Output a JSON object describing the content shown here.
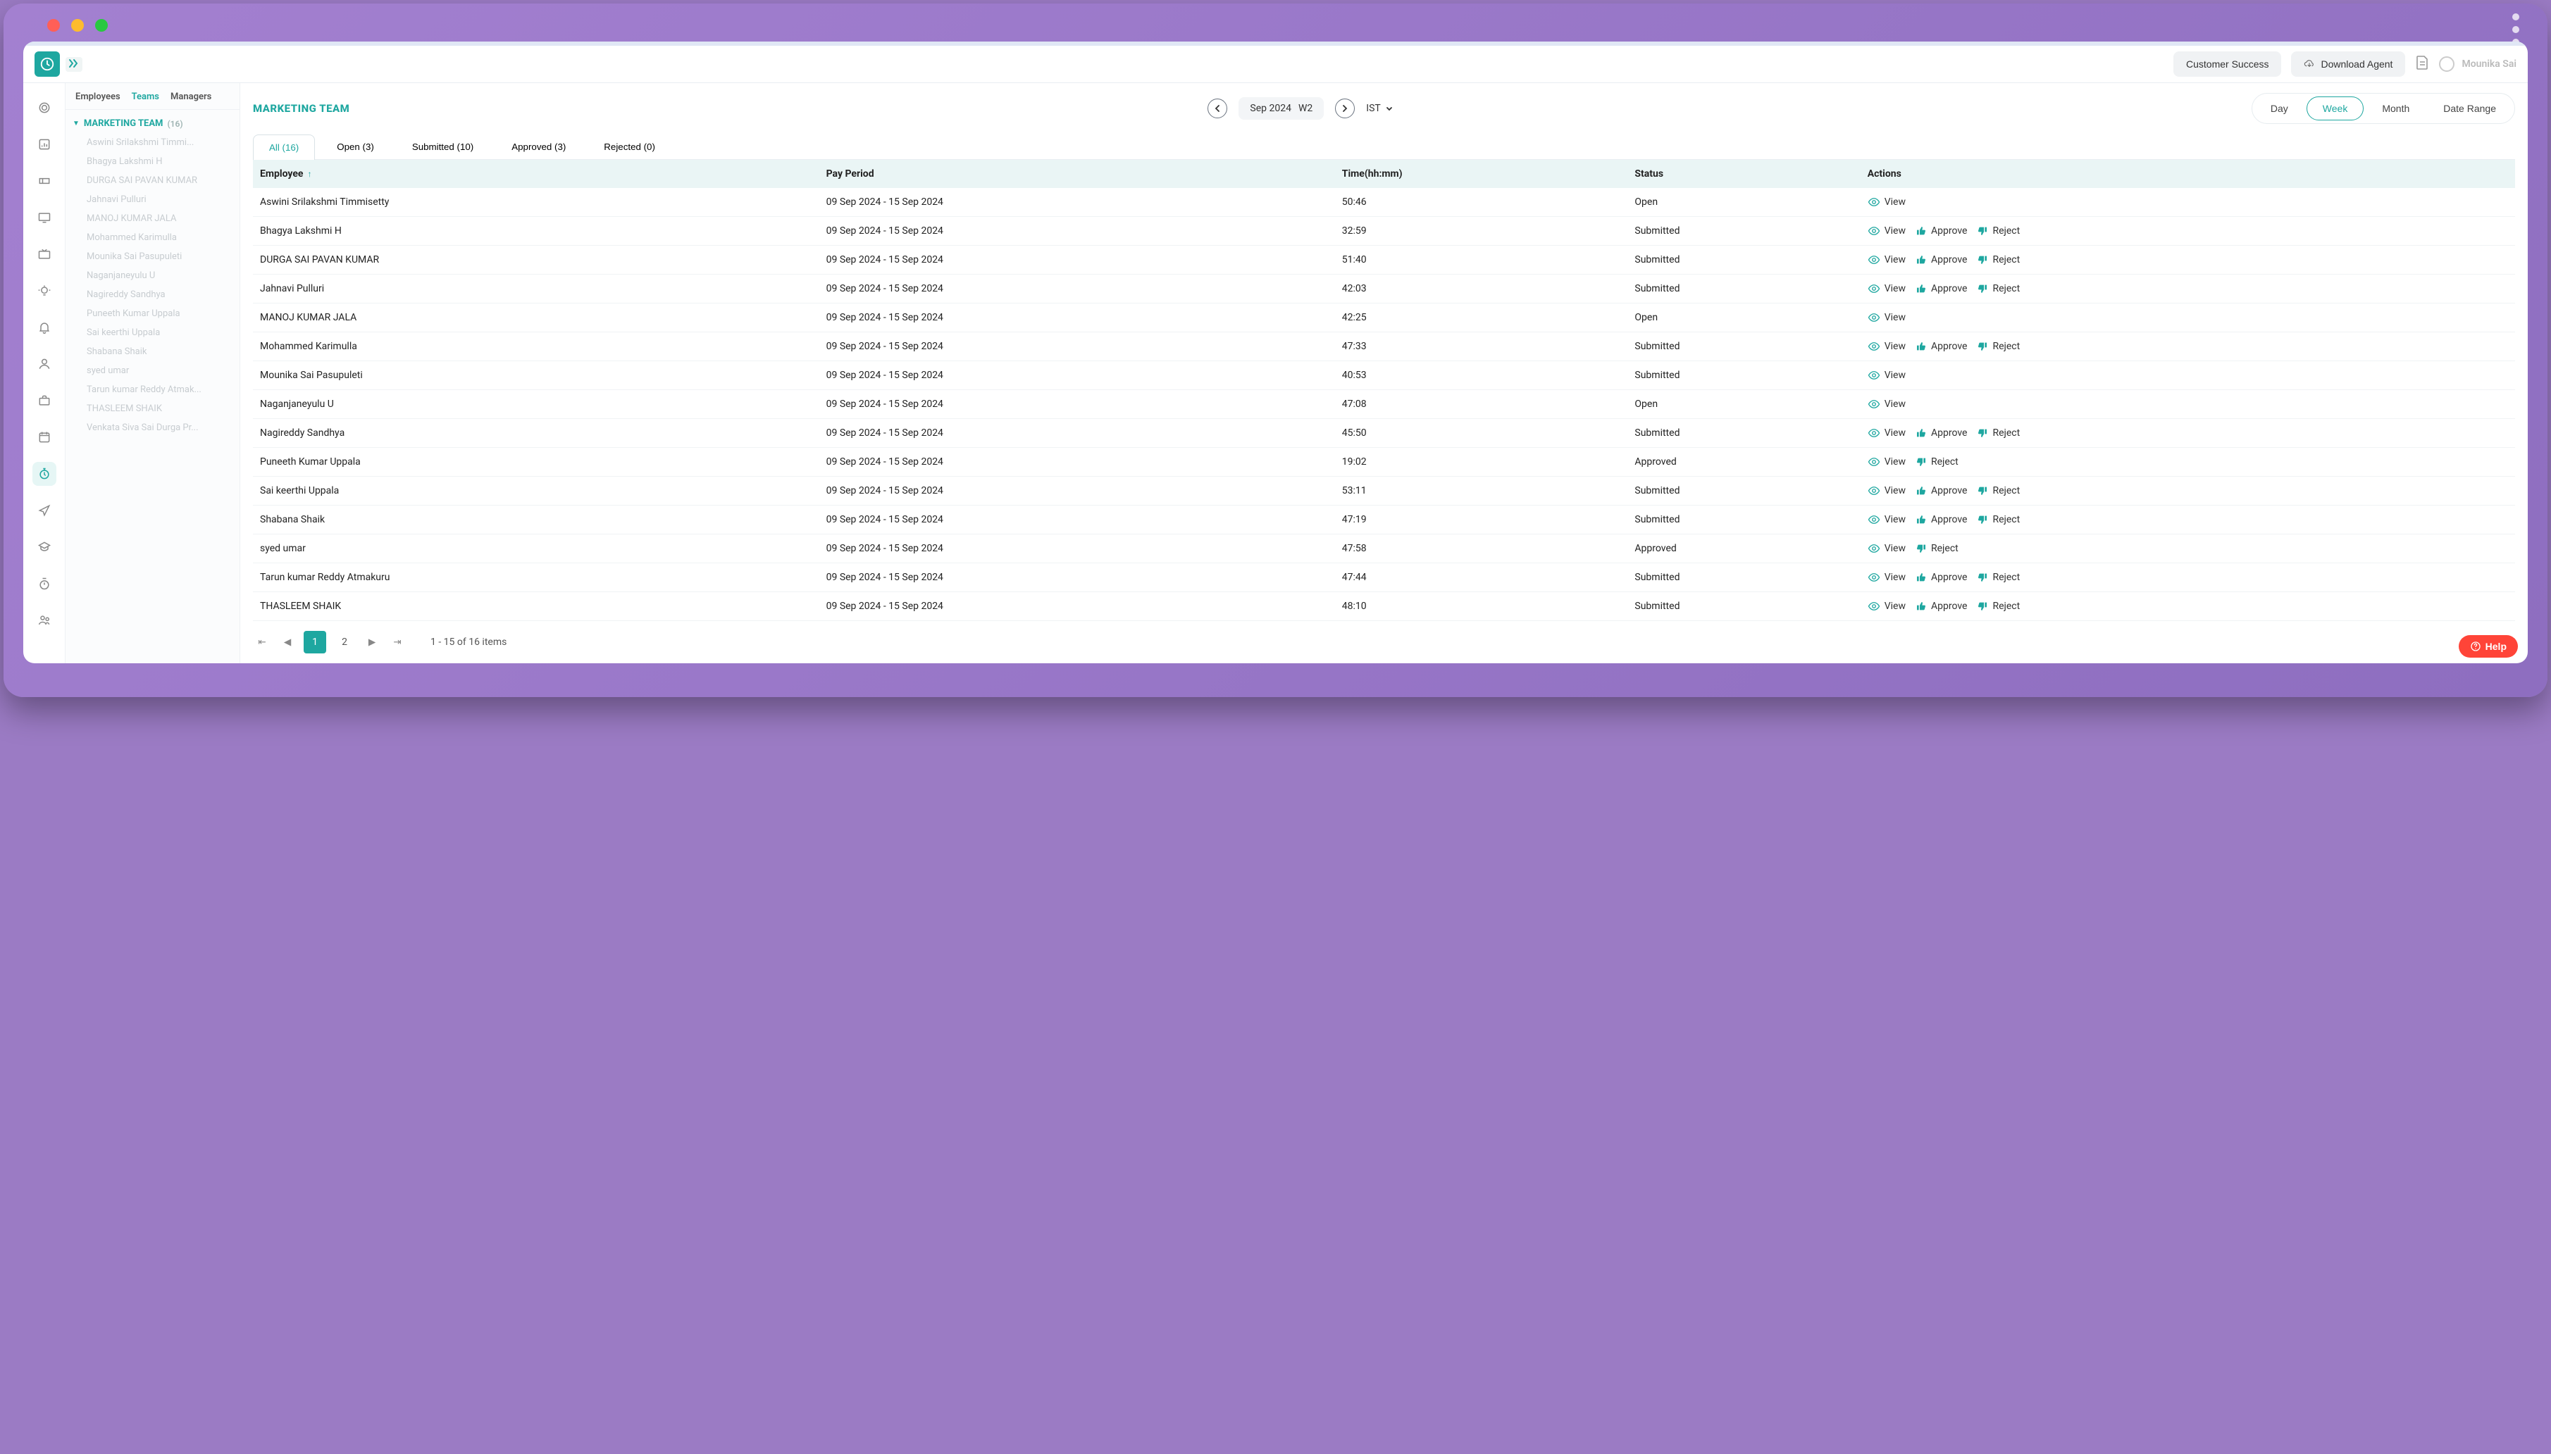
{
  "header": {
    "customer_btn": "Customer Success",
    "download_btn": "Download Agent",
    "user_name": "Mounika Sai"
  },
  "side_tabs": {
    "employees": "Employees",
    "teams": "Teams",
    "managers": "Managers"
  },
  "team": {
    "name": "MARKETING TEAM",
    "count": "(16)"
  },
  "employees": [
    "Aswini Srilakshmi Timmi...",
    "Bhagya Lakshmi H",
    "DURGA SAI PAVAN KUMAR",
    "Jahnavi Pulluri",
    "MANOJ KUMAR JALA",
    "Mohammed Karimulla",
    "Mounika Sai Pasupuleti",
    "Naganjaneyulu U",
    "Nagireddy Sandhya",
    "Puneeth Kumar Uppala",
    "Sai keerthi Uppala",
    "Shabana Shaik",
    "syed umar",
    "Tarun kumar Reddy Atmak...",
    "THASLEEM SHAIK",
    "Venkata Siva Sai Durga Pr..."
  ],
  "main": {
    "title": "MARKETING TEAM",
    "period_month": "Sep 2024",
    "period_week": "W2",
    "tz": "IST",
    "range": {
      "day": "Day",
      "week": "Week",
      "month": "Month",
      "daterange": "Date Range"
    }
  },
  "filters": {
    "all": "All (16)",
    "open": "Open (3)",
    "submitted": "Submitted (10)",
    "approved": "Approved (3)",
    "rejected": "Rejected (0)"
  },
  "columns": {
    "employee": "Employee",
    "payperiod": "Pay Period",
    "time": "Time(hh:mm)",
    "status": "Status",
    "actions": "Actions"
  },
  "action_labels": {
    "view": "View",
    "approve": "Approve",
    "reject": "Reject"
  },
  "rows": [
    {
      "emp": "Aswini Srilakshmi Timmisetty",
      "pp": "09 Sep 2024 - 15 Sep 2024",
      "time": "50:46",
      "status": "Open",
      "acts": [
        "view"
      ]
    },
    {
      "emp": "Bhagya Lakshmi H",
      "pp": "09 Sep 2024 - 15 Sep 2024",
      "time": "32:59",
      "status": "Submitted",
      "acts": [
        "view",
        "approve",
        "reject"
      ]
    },
    {
      "emp": "DURGA SAI PAVAN KUMAR",
      "pp": "09 Sep 2024 - 15 Sep 2024",
      "time": "51:40",
      "status": "Submitted",
      "acts": [
        "view",
        "approve",
        "reject"
      ]
    },
    {
      "emp": "Jahnavi Pulluri",
      "pp": "09 Sep 2024 - 15 Sep 2024",
      "time": "42:03",
      "status": "Submitted",
      "acts": [
        "view",
        "approve",
        "reject"
      ]
    },
    {
      "emp": "MANOJ KUMAR JALA",
      "pp": "09 Sep 2024 - 15 Sep 2024",
      "time": "42:25",
      "status": "Open",
      "acts": [
        "view"
      ]
    },
    {
      "emp": "Mohammed Karimulla",
      "pp": "09 Sep 2024 - 15 Sep 2024",
      "time": "47:33",
      "status": "Submitted",
      "acts": [
        "view",
        "approve",
        "reject"
      ]
    },
    {
      "emp": "Mounika Sai Pasupuleti",
      "pp": "09 Sep 2024 - 15 Sep 2024",
      "time": "40:53",
      "status": "Submitted",
      "acts": [
        "view"
      ]
    },
    {
      "emp": "Naganjaneyulu U",
      "pp": "09 Sep 2024 - 15 Sep 2024",
      "time": "47:08",
      "status": "Open",
      "acts": [
        "view"
      ]
    },
    {
      "emp": "Nagireddy Sandhya",
      "pp": "09 Sep 2024 - 15 Sep 2024",
      "time": "45:50",
      "status": "Submitted",
      "acts": [
        "view",
        "approve",
        "reject"
      ]
    },
    {
      "emp": "Puneeth Kumar Uppala",
      "pp": "09 Sep 2024 - 15 Sep 2024",
      "time": "19:02",
      "status": "Approved",
      "acts": [
        "view",
        "reject"
      ]
    },
    {
      "emp": "Sai keerthi Uppala",
      "pp": "09 Sep 2024 - 15 Sep 2024",
      "time": "53:11",
      "status": "Submitted",
      "acts": [
        "view",
        "approve",
        "reject"
      ]
    },
    {
      "emp": "Shabana Shaik",
      "pp": "09 Sep 2024 - 15 Sep 2024",
      "time": "47:19",
      "status": "Submitted",
      "acts": [
        "view",
        "approve",
        "reject"
      ]
    },
    {
      "emp": "syed umar",
      "pp": "09 Sep 2024 - 15 Sep 2024",
      "time": "47:58",
      "status": "Approved",
      "acts": [
        "view",
        "reject"
      ]
    },
    {
      "emp": "Tarun kumar Reddy Atmakuru",
      "pp": "09 Sep 2024 - 15 Sep 2024",
      "time": "47:44",
      "status": "Submitted",
      "acts": [
        "view",
        "approve",
        "reject"
      ]
    },
    {
      "emp": "THASLEEM SHAIK",
      "pp": "09 Sep 2024 - 15 Sep 2024",
      "time": "48:10",
      "status": "Submitted",
      "acts": [
        "view",
        "approve",
        "reject"
      ]
    }
  ],
  "pager": {
    "pages": [
      "1",
      "2"
    ],
    "summary": "1 - 15 of 16 items"
  },
  "help": "Help"
}
